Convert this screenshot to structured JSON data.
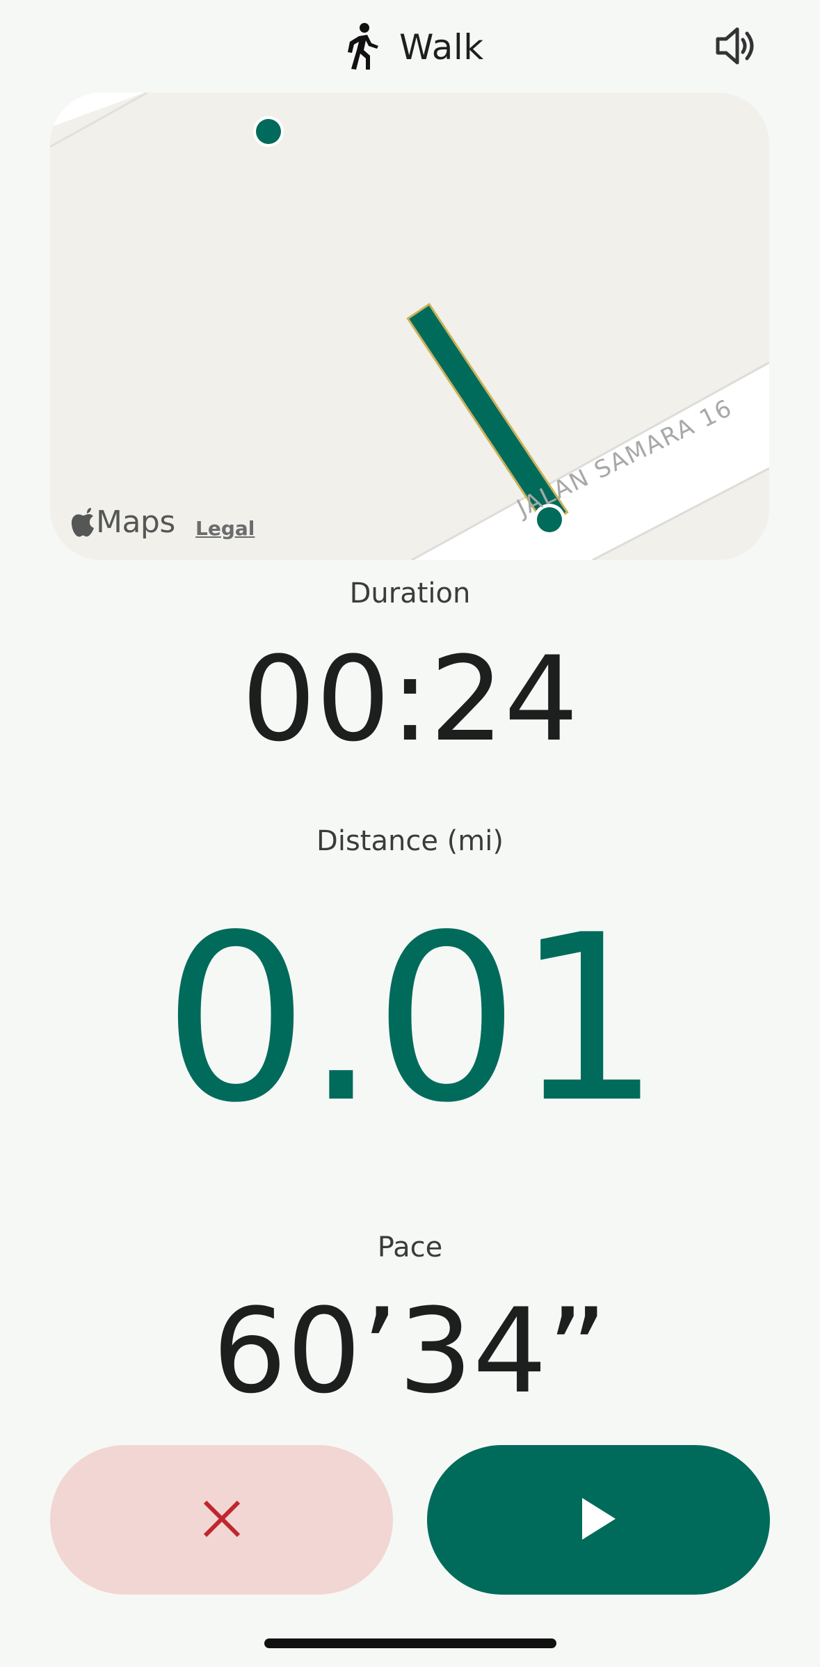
{
  "header": {
    "title": "Walk",
    "activity_icon": "walk-icon",
    "sound_icon": "speaker-icon"
  },
  "map": {
    "road_name": "JALAN SAMARA 16",
    "attribution": "Maps",
    "legal_label": "Legal",
    "route_color": "#006b5b"
  },
  "stats": {
    "duration_label": "Duration",
    "duration_value": "00:24",
    "distance_label": "Distance (mi)",
    "distance_value": "0.01",
    "pace_label": "Pace",
    "pace_value": "60’34”"
  },
  "controls": {
    "discard_icon": "close-icon",
    "resume_icon": "play-icon"
  },
  "colors": {
    "accent": "#006b5b",
    "discard_bg": "#f2d6d4",
    "discard_icon": "#c0272d",
    "background": "#f6f8f6"
  }
}
